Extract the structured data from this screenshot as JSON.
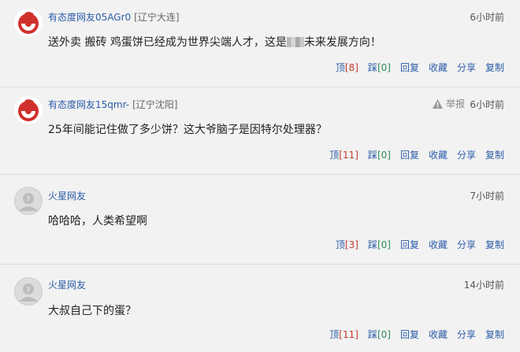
{
  "comments": [
    {
      "user": "有态度网友05AGr0",
      "location": "[辽宁大连]",
      "time": "6小时前",
      "text_a": "送外卖  搬砖  鸡蛋饼已经成为世界尖端人才，这是",
      "text_b": "未来发展方向！",
      "avatar": "netease-red-logo",
      "up": "顶",
      "up_count": "[8]",
      "down": "踩",
      "down_count": "[0]",
      "reply": "回复",
      "fav": "收藏",
      "share": "分享",
      "copy": "复制"
    },
    {
      "user": "有态度网友15qmr-",
      "location": "[辽宁沈阳]",
      "time": "6小时前",
      "report": "举报",
      "text": "25年间能记住做了多少饼？这大爷脑子是因特尔处理器？",
      "avatar": "netease-red-logo",
      "up": "顶",
      "up_count": "[11]",
      "down": "踩",
      "down_count": "[0]",
      "reply": "回复",
      "fav": "收藏",
      "share": "分享",
      "copy": "复制"
    },
    {
      "user": "火星网友",
      "location": "",
      "time": "7小时前",
      "text": "哈哈哈，人类希望啊",
      "avatar": "grey-default-avatar",
      "up": "顶",
      "up_count": "[3]",
      "down": "踩",
      "down_count": "[0]",
      "reply": "回复",
      "fav": "收藏",
      "share": "分享",
      "copy": "复制"
    },
    {
      "user": "火星网友",
      "location": "",
      "time": "14小时前",
      "text": "大叔自己下的蛋？",
      "avatar": "grey-default-avatar",
      "up": "顶",
      "up_count": "[11]",
      "down": "踩",
      "down_count": "[0]",
      "reply": "回复",
      "fav": "收藏",
      "share": "分享",
      "copy": "复制"
    }
  ],
  "colors": {
    "background": "#f2f2f2",
    "username": "#2b5ca8",
    "up_count": "#c0392b",
    "down_count": "#2e8b57",
    "netease_red": "#d0302b"
  }
}
